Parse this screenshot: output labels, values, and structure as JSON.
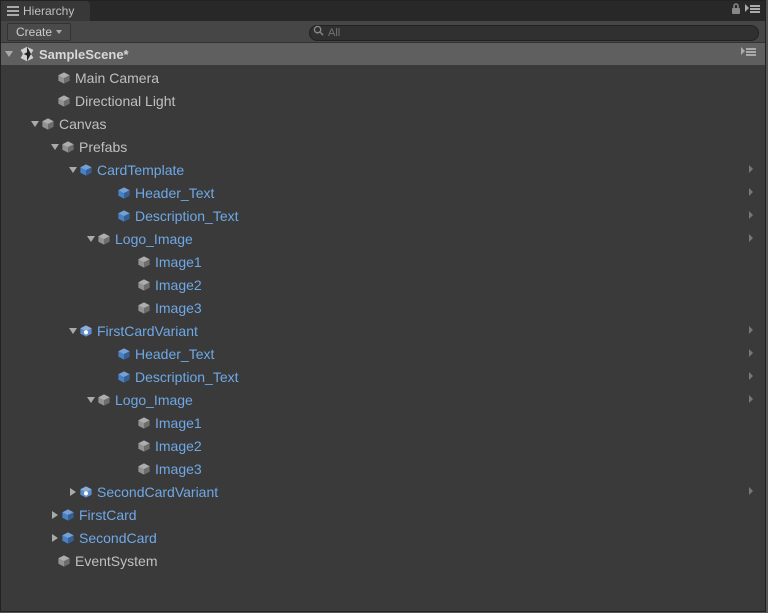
{
  "panel": {
    "title": "Hierarchy"
  },
  "toolbar": {
    "create": "Create",
    "search_placeholder": "All"
  },
  "scene": {
    "name": "SampleScene*"
  },
  "nodes": [
    {
      "label": "Main Camera",
      "color": "gray",
      "icon": "gray",
      "indent": 1,
      "toggle": "none",
      "chev": false
    },
    {
      "label": "Directional Light",
      "color": "gray",
      "icon": "gray",
      "indent": 1,
      "toggle": "none",
      "chev": false
    },
    {
      "label": "Canvas",
      "color": "gray",
      "icon": "gray",
      "indent": 2,
      "toggle": "open",
      "chev": false
    },
    {
      "label": "Prefabs",
      "color": "gray",
      "icon": "gray",
      "indent": 3,
      "toggle": "open",
      "chev": false
    },
    {
      "label": "CardTemplate",
      "color": "blue",
      "icon": "blue",
      "indent": 4,
      "toggle": "open",
      "chev": true
    },
    {
      "label": "Header_Text",
      "color": "blue",
      "icon": "blue",
      "indent": 6,
      "toggle": "none",
      "chev": true
    },
    {
      "label": "Description_Text",
      "color": "blue",
      "icon": "blue",
      "indent": 6,
      "toggle": "none",
      "chev": true
    },
    {
      "label": "Logo_Image",
      "color": "blue",
      "icon": "gray",
      "indent": 5,
      "toggle": "open",
      "chev": true
    },
    {
      "label": "Image1",
      "color": "blue",
      "icon": "gray",
      "indent": 7,
      "toggle": "none",
      "chev": false
    },
    {
      "label": "Image2",
      "color": "blue",
      "icon": "gray",
      "indent": 7,
      "toggle": "none",
      "chev": false
    },
    {
      "label": "Image3",
      "color": "blue",
      "icon": "gray",
      "indent": 7,
      "toggle": "none",
      "chev": false
    },
    {
      "label": "FirstCardVariant",
      "color": "blue",
      "icon": "bluev",
      "indent": 4,
      "toggle": "open",
      "chev": true
    },
    {
      "label": "Header_Text",
      "color": "blue",
      "icon": "blue",
      "indent": 6,
      "toggle": "none",
      "chev": true
    },
    {
      "label": "Description_Text",
      "color": "blue",
      "icon": "blue",
      "indent": 6,
      "toggle": "none",
      "chev": true
    },
    {
      "label": "Logo_Image",
      "color": "blue",
      "icon": "gray",
      "indent": 5,
      "toggle": "open",
      "chev": true
    },
    {
      "label": "Image1",
      "color": "blue",
      "icon": "gray",
      "indent": 7,
      "toggle": "none",
      "chev": false
    },
    {
      "label": "Image2",
      "color": "blue",
      "icon": "gray",
      "indent": 7,
      "toggle": "none",
      "chev": false
    },
    {
      "label": "Image3",
      "color": "blue",
      "icon": "gray",
      "indent": 7,
      "toggle": "none",
      "chev": false
    },
    {
      "label": "SecondCardVariant",
      "color": "blue",
      "icon": "bluev",
      "indent": 4,
      "toggle": "closed",
      "chev": true
    },
    {
      "label": "FirstCard",
      "color": "blue",
      "icon": "blue",
      "indent": 3,
      "toggle": "closed",
      "chev": false
    },
    {
      "label": "SecondCard",
      "color": "blue",
      "icon": "blue",
      "indent": 3,
      "toggle": "closed",
      "chev": false
    },
    {
      "label": "EventSystem",
      "color": "gray",
      "icon": "gray",
      "indent": 1,
      "toggle": "none",
      "chev": false
    }
  ]
}
